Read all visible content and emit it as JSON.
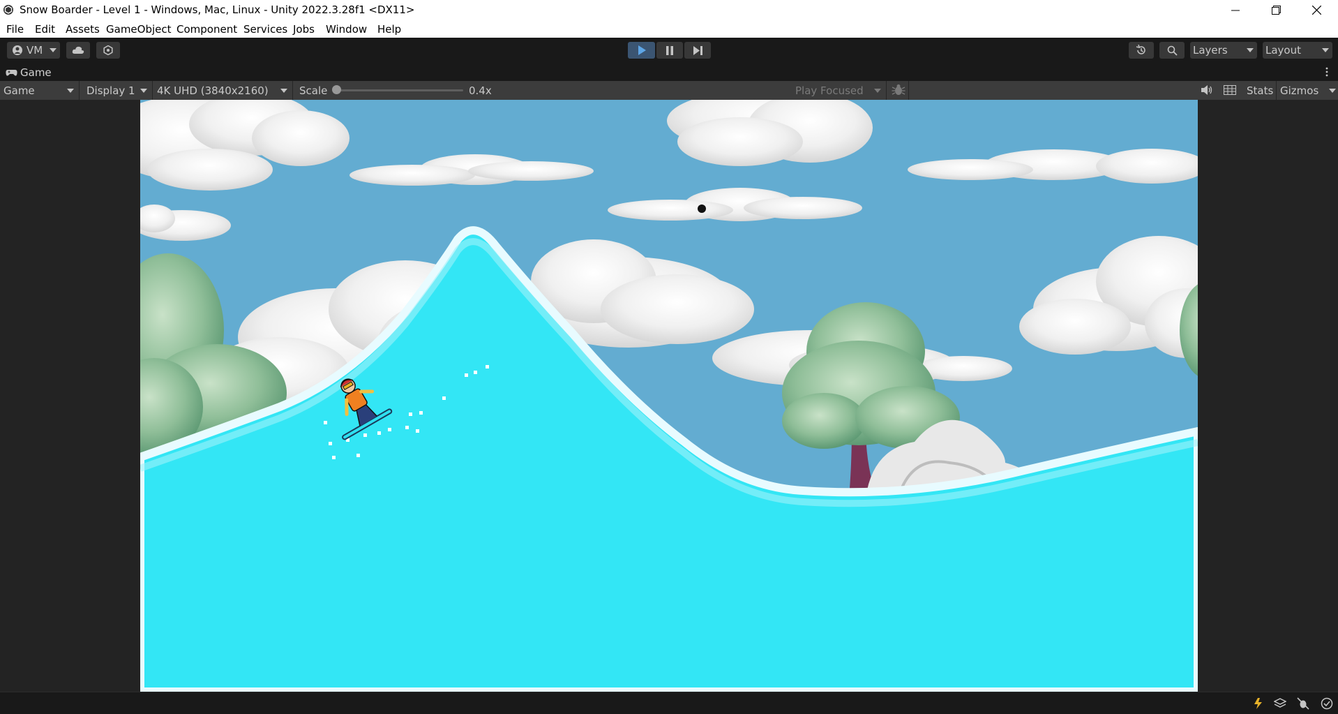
{
  "window": {
    "title": "Snow Boarder - Level 1 - Windows, Mac, Linux - Unity 2022.3.28f1 <DX11>",
    "controls": [
      "minimize-icon",
      "restore-icon",
      "close-icon"
    ]
  },
  "menu": [
    "File",
    "Edit",
    "Assets",
    "GameObject",
    "Component",
    "Services",
    "Jobs",
    "Window",
    "Help"
  ],
  "toolbar": {
    "account_label": "VM",
    "play_state": "playing",
    "layers_label": "Layers",
    "layout_label": "Layout"
  },
  "game_tab": {
    "label": "Game"
  },
  "game_options": {
    "view_mode": "Game",
    "display": "Display 1",
    "resolution": "4K UHD (3840x2160)",
    "scale_label": "Scale",
    "scale_value": "0.4x",
    "play_mode": "Play Focused",
    "stats_label": "Stats",
    "gizmos_label": "Gizmos"
  },
  "colors": {
    "sky": "#63acd1",
    "snow": "#33e6f5",
    "snow_rim": "#e8fbff",
    "tree_foliage": "#88bb92",
    "tree_trunk": "#7a3356",
    "play_active": "#3b5572"
  }
}
